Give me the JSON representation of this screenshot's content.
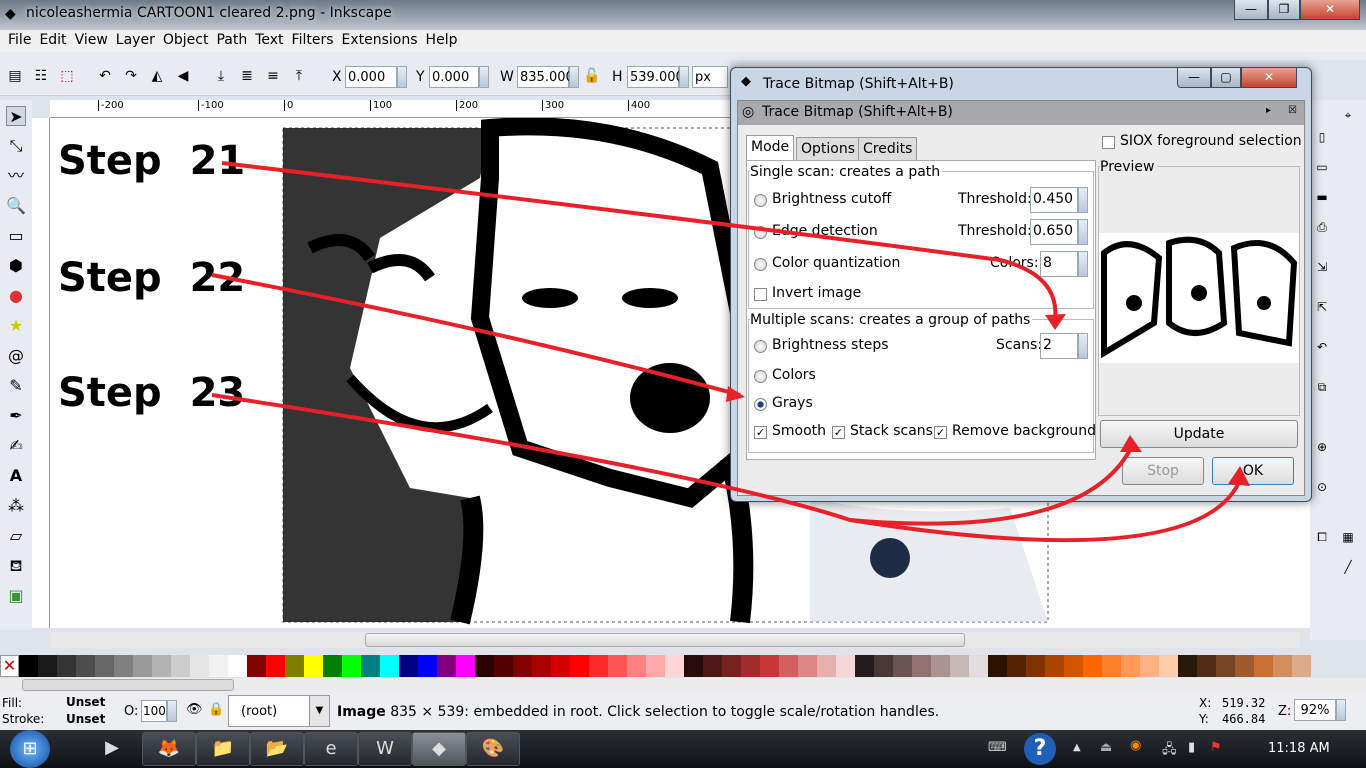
{
  "window": {
    "title": "nicoleashermia CARTOON1 cleared 2.png - Inkscape"
  },
  "menu": [
    "File",
    "Edit",
    "View",
    "Layer",
    "Object",
    "Path",
    "Text",
    "Filters",
    "Extensions",
    "Help"
  ],
  "toolbar": {
    "x_label": "X",
    "x": "0.000",
    "y_label": "Y",
    "y": "0.000",
    "w_label": "W",
    "w": "835.000",
    "h_label": "H",
    "h": "539.000",
    "unit": "px"
  },
  "ruler_top": [
    "-200",
    "-100",
    "0",
    "100",
    "200",
    "300",
    "400"
  ],
  "annotations": [
    {
      "word": "Step",
      "num": "21"
    },
    {
      "word": "Step",
      "num": "22"
    },
    {
      "word": "Step",
      "num": "23"
    }
  ],
  "annotation_color": "#e8202a",
  "dialog": {
    "window_title": "Trace Bitmap (Shift+Alt+B)",
    "panel_title": "Trace Bitmap (Shift+Alt+B)",
    "tabs": [
      "Mode",
      "Options",
      "Credits"
    ],
    "active_tab": "Mode",
    "siox": "SIOX foreground selection",
    "single_title": "Single scan: creates a path",
    "brightness": "Brightness cutoff",
    "brightness_th_label": "Threshold:",
    "brightness_th": "0.450",
    "edge": "Edge detection",
    "edge_th_label": "Threshold:",
    "edge_th": "0.650",
    "colorq": "Color quantization",
    "colors_label": "Colors:",
    "colors": "8",
    "invert": "Invert image",
    "multi_title": "Multiple scans: creates a group of paths",
    "bsteps": "Brightness steps",
    "scans_label": "Scans:",
    "scans": "2",
    "mcolors": "Colors",
    "grays": "Grays",
    "smooth": "Smooth",
    "stack": "Stack scans",
    "remove_bg": "Remove background",
    "preview": "Preview",
    "update": "Update",
    "stop": "Stop",
    "ok": "OK",
    "selected_mode": "Grays"
  },
  "palette": [
    "#000000",
    "#1a1a1a",
    "#333333",
    "#4d4d4d",
    "#666666",
    "#808080",
    "#999999",
    "#b3b3b3",
    "#cccccc",
    "#e6e6e6",
    "#f2f2f2",
    "#ffffff",
    "#800000",
    "#ff0000",
    "#808000",
    "#ffff00",
    "#008000",
    "#00ff00",
    "#008080",
    "#00ffff",
    "#000080",
    "#0000ff",
    "#800080",
    "#ff00ff",
    "#2b0000",
    "#550000",
    "#800000",
    "#aa0000",
    "#d40000",
    "#ff0000",
    "#ff2a2a",
    "#ff5555",
    "#ff8080",
    "#ffaaaa",
    "#ffd5d5",
    "#280b0b",
    "#501616",
    "#782121",
    "#a02c2c",
    "#c83737",
    "#d35f5f",
    "#de8787",
    "#e9afaf",
    "#f4d7d7",
    "#241c1c",
    "#483737",
    "#6c5353",
    "#917070",
    "#ac9393",
    "#c8b7b7",
    "#e3dbdb",
    "#2b1100",
    "#552200",
    "#803300",
    "#aa4400",
    "#d45500",
    "#ff6600",
    "#ff7f2a",
    "#ff9955",
    "#ffb380",
    "#ffccaa",
    "#28170b",
    "#502d16",
    "#784421",
    "#a05a2c",
    "#c87137",
    "#d38d5f",
    "#deaa87"
  ],
  "status": {
    "fill_label": "Fill:",
    "fill": "Unset",
    "stroke_label": "Stroke:",
    "stroke": "Unset",
    "opacity_label": "O:",
    "opacity": "100",
    "layer": "(root)",
    "message_bold": "Image",
    "message": "835 × 539: embedded in root. Click selection to toggle scale/rotation handles.",
    "x_label": "X:",
    "x": "519.32",
    "y_label": "Y:",
    "y": "466.84",
    "zoom_label": "Z:",
    "zoom": "92%"
  },
  "taskbar": {
    "clock": "11:18 AM"
  }
}
